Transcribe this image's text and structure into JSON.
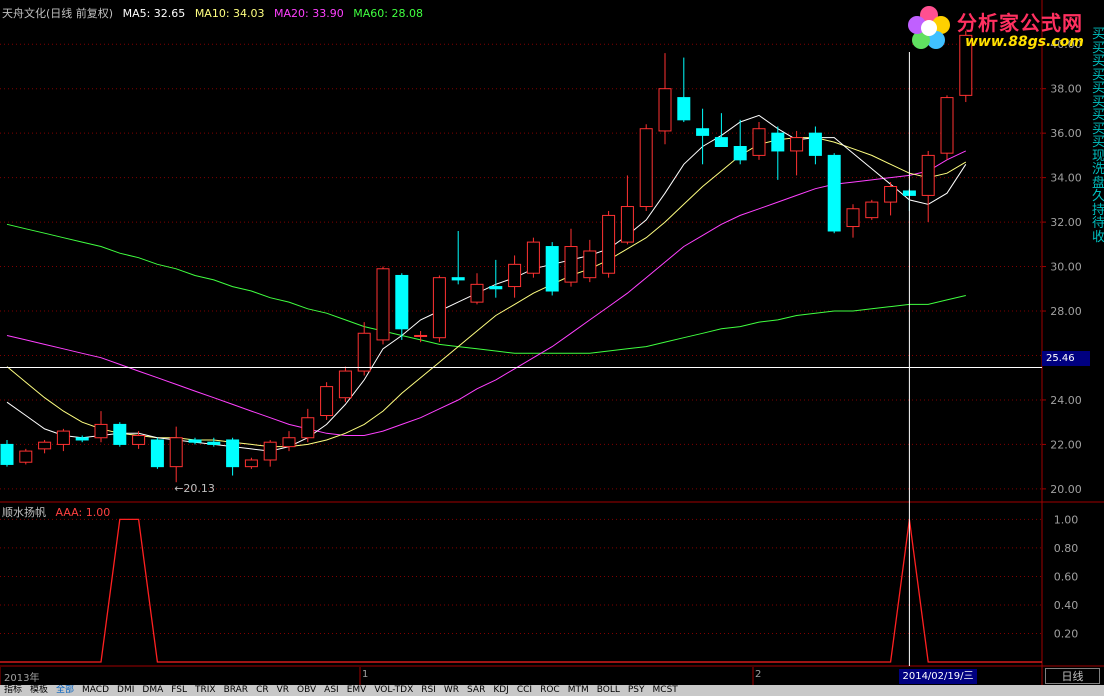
{
  "header": {
    "title": "天舟文化(日线 前复权)",
    "ma": [
      {
        "label": "MA5: 32.65",
        "color": "#ffffff"
      },
      {
        "label": "MA10: 34.03",
        "color": "#ffff80"
      },
      {
        "label": "MA20: 33.90",
        "color": "#ff40ff"
      },
      {
        "label": "MA60: 28.08",
        "color": "#40ff40"
      }
    ]
  },
  "logo": {
    "name": "分析家公式网",
    "url": "www.88gs.com"
  },
  "indicator": {
    "name": "顺水扬帆",
    "value_label": "AAA: 1.00"
  },
  "cursor": {
    "price_label": "25.46",
    "date_label": "2014/02/19/三"
  },
  "low_label": "←20.13",
  "period_label": "日线",
  "x_axis": {
    "labels": [
      "2013年",
      "1",
      "2"
    ]
  },
  "side_text": "买买买买买买买买买现洗盘久持待收",
  "price_axis": {
    "ticks": [
      "40.00",
      "38.00",
      "36.00",
      "34.00",
      "32.00",
      "30.00",
      "28.00",
      "26.00",
      "24.00",
      "22.00",
      "20.00"
    ]
  },
  "ind_axis": {
    "ticks": [
      "1.00",
      "0.80",
      "0.60",
      "0.40",
      "0.20"
    ]
  },
  "tabs": [
    "指标",
    "模板",
    "全部",
    "MACD",
    "DMI",
    "DMA",
    "FSL",
    "TRIX",
    "BRAR",
    "CR",
    "VR",
    "OBV",
    "ASI",
    "EMV",
    "VOL-TDX",
    "RSI",
    "WR",
    "SAR",
    "KDJ",
    "CCI",
    "ROC",
    "MTM",
    "BOLL",
    "PSY",
    "MCST"
  ],
  "colors": {
    "up": "#ff3232",
    "down": "#00ffff",
    "ma5": "#ffffff",
    "ma10": "#ffff80",
    "ma20": "#ff40ff",
    "ma60": "#40ff40",
    "grid": "#800000",
    "ind": "#ff2020"
  },
  "chart_data": {
    "type": "candlestick",
    "ylim": [
      19.5,
      41
    ],
    "candles": [
      {
        "o": 22.0,
        "h": 22.2,
        "l": 21.0,
        "c": 21.1
      },
      {
        "o": 21.2,
        "h": 21.8,
        "l": 21.1,
        "c": 21.7
      },
      {
        "o": 21.8,
        "h": 22.2,
        "l": 21.6,
        "c": 22.1
      },
      {
        "o": 22.0,
        "h": 22.7,
        "l": 21.7,
        "c": 22.6
      },
      {
        "o": 22.3,
        "h": 22.4,
        "l": 22.1,
        "c": 22.2
      },
      {
        "o": 22.3,
        "h": 23.5,
        "l": 22.1,
        "c": 22.9
      },
      {
        "o": 22.9,
        "h": 23.0,
        "l": 21.9,
        "c": 22.0
      },
      {
        "o": 22.0,
        "h": 22.6,
        "l": 21.8,
        "c": 22.4
      },
      {
        "o": 22.2,
        "h": 22.3,
        "l": 20.9,
        "c": 21.0
      },
      {
        "o": 21.0,
        "h": 22.8,
        "l": 20.3,
        "c": 22.3
      },
      {
        "o": 22.2,
        "h": 22.3,
        "l": 22.0,
        "c": 22.1
      },
      {
        "o": 22.1,
        "h": 22.3,
        "l": 21.9,
        "c": 22.0
      },
      {
        "o": 22.2,
        "h": 22.3,
        "l": 20.6,
        "c": 21.0
      },
      {
        "o": 21.0,
        "h": 21.4,
        "l": 20.9,
        "c": 21.3
      },
      {
        "o": 21.3,
        "h": 22.2,
        "l": 21.0,
        "c": 22.1
      },
      {
        "o": 21.9,
        "h": 22.6,
        "l": 21.7,
        "c": 22.3
      },
      {
        "o": 22.3,
        "h": 23.6,
        "l": 22.1,
        "c": 23.2
      },
      {
        "o": 23.3,
        "h": 24.8,
        "l": 23.1,
        "c": 24.6
      },
      {
        "o": 24.1,
        "h": 25.5,
        "l": 23.9,
        "c": 25.3
      },
      {
        "o": 25.3,
        "h": 27.5,
        "l": 25.1,
        "c": 27.0
      },
      {
        "o": 26.7,
        "h": 30.0,
        "l": 26.5,
        "c": 29.9
      },
      {
        "o": 29.6,
        "h": 29.7,
        "l": 26.7,
        "c": 27.2
      },
      {
        "o": 26.9,
        "h": 27.1,
        "l": 26.6,
        "c": 26.9
      },
      {
        "o": 26.8,
        "h": 29.6,
        "l": 26.6,
        "c": 29.5
      },
      {
        "o": 29.5,
        "h": 31.6,
        "l": 29.2,
        "c": 29.4
      },
      {
        "o": 28.4,
        "h": 29.7,
        "l": 28.3,
        "c": 29.2
      },
      {
        "o": 29.1,
        "h": 30.3,
        "l": 28.6,
        "c": 29.0
      },
      {
        "o": 29.1,
        "h": 30.5,
        "l": 28.6,
        "c": 30.1
      },
      {
        "o": 29.7,
        "h": 31.3,
        "l": 29.5,
        "c": 31.1
      },
      {
        "o": 30.9,
        "h": 31.1,
        "l": 28.7,
        "c": 28.9
      },
      {
        "o": 29.3,
        "h": 31.7,
        "l": 29.1,
        "c": 30.9
      },
      {
        "o": 29.5,
        "h": 31.2,
        "l": 29.3,
        "c": 30.7
      },
      {
        "o": 29.7,
        "h": 32.5,
        "l": 29.5,
        "c": 32.3
      },
      {
        "o": 31.1,
        "h": 34.1,
        "l": 31.0,
        "c": 32.7
      },
      {
        "o": 32.7,
        "h": 36.4,
        "l": 32.5,
        "c": 36.2
      },
      {
        "o": 36.1,
        "h": 39.6,
        "l": 35.5,
        "c": 38.0
      },
      {
        "o": 37.6,
        "h": 39.4,
        "l": 36.5,
        "c": 36.6
      },
      {
        "o": 36.2,
        "h": 37.1,
        "l": 34.6,
        "c": 35.9
      },
      {
        "o": 35.8,
        "h": 36.9,
        "l": 35.4,
        "c": 35.4
      },
      {
        "o": 35.4,
        "h": 36.6,
        "l": 34.6,
        "c": 34.8
      },
      {
        "o": 35.0,
        "h": 36.5,
        "l": 34.8,
        "c": 36.2
      },
      {
        "o": 36.0,
        "h": 36.3,
        "l": 33.9,
        "c": 35.2
      },
      {
        "o": 35.2,
        "h": 36.1,
        "l": 34.1,
        "c": 35.8
      },
      {
        "o": 36.0,
        "h": 36.3,
        "l": 34.6,
        "c": 35.0
      },
      {
        "o": 35.0,
        "h": 35.1,
        "l": 31.5,
        "c": 31.6
      },
      {
        "o": 31.8,
        "h": 32.8,
        "l": 31.3,
        "c": 32.6
      },
      {
        "o": 32.2,
        "h": 33.0,
        "l": 32.1,
        "c": 32.9
      },
      {
        "o": 32.9,
        "h": 33.8,
        "l": 32.3,
        "c": 33.6
      },
      {
        "o": 33.4,
        "h": 33.5,
        "l": 32.5,
        "c": 33.2
      },
      {
        "o": 33.2,
        "h": 35.2,
        "l": 32.0,
        "c": 35.0
      },
      {
        "o": 35.1,
        "h": 37.7,
        "l": 34.8,
        "c": 37.6
      },
      {
        "o": 37.7,
        "h": 40.6,
        "l": 37.4,
        "c": 40.4
      }
    ],
    "ma5": [
      23.9,
      23.3,
      22.7,
      22.4,
      22.3,
      22.4,
      22.5,
      22.5,
      22.3,
      22.2,
      22.1,
      22.0,
      21.9,
      21.8,
      21.7,
      21.9,
      22.3,
      22.9,
      23.8,
      24.9,
      26.3,
      26.9,
      27.6,
      28.0,
      28.4,
      28.8,
      29.2,
      29.5,
      29.9,
      30.1,
      30.3,
      30.5,
      30.8,
      31.4,
      32.1,
      33.3,
      34.6,
      35.4,
      35.9,
      36.5,
      36.8,
      36.2,
      35.7,
      35.8,
      35.8,
      35.1,
      34.4,
      33.7,
      33.0,
      32.8,
      33.3,
      34.6
    ],
    "ma10": [
      25.5,
      24.8,
      24.1,
      23.5,
      23.0,
      22.7,
      22.5,
      22.4,
      22.3,
      22.3,
      22.2,
      22.2,
      22.1,
      22.0,
      21.9,
      21.9,
      22.0,
      22.2,
      22.5,
      22.9,
      23.5,
      24.3,
      25.0,
      25.7,
      26.4,
      27.1,
      27.8,
      28.3,
      28.8,
      29.2,
      29.6,
      29.9,
      30.3,
      30.8,
      31.3,
      32.0,
      32.8,
      33.6,
      34.3,
      35.0,
      35.5,
      35.7,
      35.8,
      35.8,
      35.6,
      35.3,
      35.0,
      34.6,
      34.2,
      34.0,
      34.2,
      34.7
    ],
    "ma20": [
      26.9,
      26.7,
      26.5,
      26.3,
      26.1,
      25.9,
      25.6,
      25.3,
      25.0,
      24.7,
      24.4,
      24.1,
      23.8,
      23.5,
      23.2,
      22.9,
      22.7,
      22.5,
      22.4,
      22.4,
      22.6,
      22.9,
      23.2,
      23.6,
      24.0,
      24.5,
      24.9,
      25.4,
      25.9,
      26.4,
      27.0,
      27.6,
      28.2,
      28.8,
      29.5,
      30.2,
      30.9,
      31.4,
      31.9,
      32.3,
      32.6,
      32.9,
      33.2,
      33.5,
      33.7,
      33.8,
      33.9,
      34.0,
      34.1,
      34.3,
      34.8,
      35.2
    ],
    "ma60": [
      31.9,
      31.7,
      31.5,
      31.3,
      31.1,
      30.9,
      30.6,
      30.4,
      30.1,
      29.9,
      29.6,
      29.4,
      29.1,
      28.9,
      28.6,
      28.4,
      28.1,
      27.9,
      27.6,
      27.3,
      27.1,
      26.9,
      26.7,
      26.5,
      26.4,
      26.3,
      26.2,
      26.1,
      26.1,
      26.1,
      26.1,
      26.1,
      26.2,
      26.3,
      26.4,
      26.6,
      26.8,
      27.0,
      27.2,
      27.3,
      27.5,
      27.6,
      27.8,
      27.9,
      28.0,
      28.0,
      28.1,
      28.2,
      28.3,
      28.3,
      28.5,
      28.7
    ],
    "indicator": {
      "ylim": [
        0,
        1.08
      ],
      "values": [
        0,
        0,
        0,
        0,
        0,
        0,
        1,
        1,
        0,
        0,
        0,
        0,
        0,
        0,
        0,
        0,
        0,
        0,
        0,
        0,
        0,
        0,
        0,
        0,
        0,
        0,
        0,
        0,
        0,
        0,
        0,
        0,
        0,
        0,
        0,
        0,
        0,
        0,
        0,
        0,
        0,
        0,
        0,
        0,
        0,
        0,
        0,
        0,
        1,
        0,
        0,
        0
      ]
    }
  }
}
